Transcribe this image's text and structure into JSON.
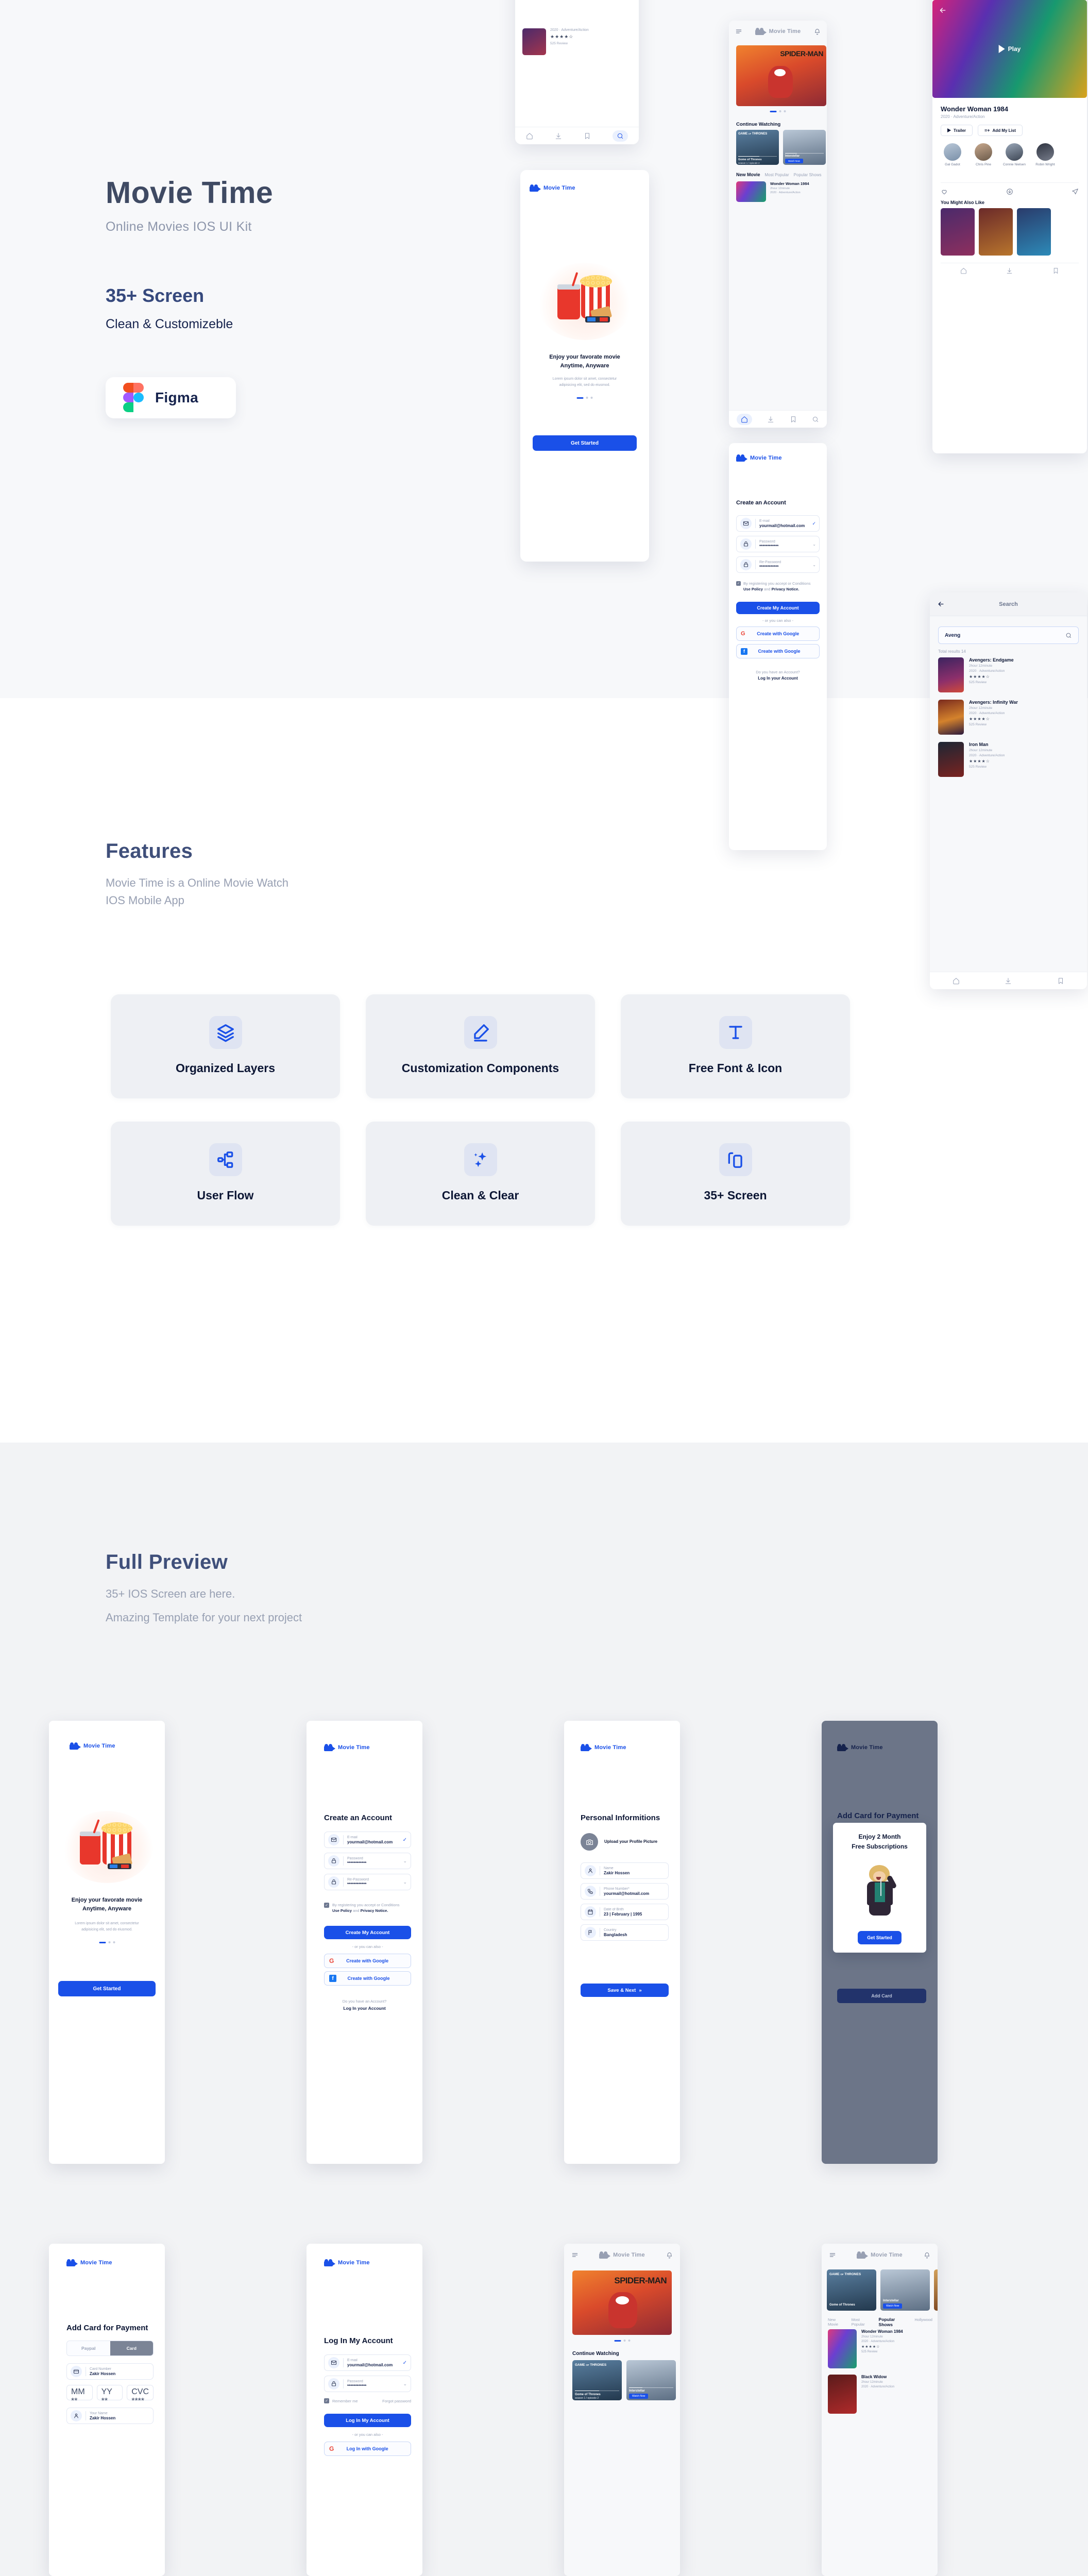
{
  "hero": {
    "title": "Movie Time",
    "subtitle": "Online Movies IOS UI Kit",
    "screens_count": "35+ Screen",
    "tagline": "Clean & Customizeble",
    "figma_label": "Figma"
  },
  "features": {
    "title": "Features",
    "subtitle_line1": "Movie Time is a Online Movie Watch",
    "subtitle_line2": "IOS Mobile App",
    "cards": [
      {
        "label": "Organized Layers",
        "icon": "layers-icon"
      },
      {
        "label": "Customization Components",
        "icon": "pencil-icon"
      },
      {
        "label": "Free Font & Icon",
        "icon": "text-icon"
      },
      {
        "label": "User Flow",
        "icon": "flow-icon"
      },
      {
        "label": "Clean & Clear",
        "icon": "sparkle-icon"
      },
      {
        "label": "35+ Screen",
        "icon": "devices-icon"
      }
    ]
  },
  "preview": {
    "title": "Full Preview",
    "subtitle_line1": "35+ IOS Screen are here.",
    "subtitle_line2": "Amazing Template for your next project"
  },
  "app": {
    "brand": "Movie Time",
    "onboarding": {
      "headline_line1": "Enjoy your favorate movie",
      "headline_line2": "Anytime, Anyware",
      "body_line1": "Lorem ipsum dolor sit amet, consectetur",
      "body_line2": "adipisicing elit, sed do eiusmod.",
      "cta": "Get Started"
    },
    "signup": {
      "title": "Create an Account",
      "fields": [
        {
          "label": "E-mail",
          "value": "yourmail@hotmail.com",
          "icon": "mail-icon"
        },
        {
          "label": "Password",
          "value": "************",
          "icon": "lock-icon"
        },
        {
          "label": "Re-Password",
          "value": "************",
          "icon": "lock-icon"
        }
      ],
      "consent_line1": "By registering you accept or Conditions",
      "consent_policy": "Use Policy",
      "consent_and": "and",
      "consent_notice": "Privacy Notice.",
      "primary_cta": "Create My Account",
      "divider": "- or you can also -",
      "google_cta": "Create with Google",
      "facebook_cta": "Create with Google",
      "footer_question": "Do you have an Account?",
      "footer_link": "Log In your Account"
    },
    "personal": {
      "title": "Personal Informitions",
      "upload_label": "Upload your Profile Picture",
      "fields": [
        {
          "label": "Name",
          "value": "Zakir Hossen",
          "icon": "user-icon"
        },
        {
          "label": "Phone Number*",
          "value": "yourmail@hotmail.com",
          "icon": "phone-icon"
        },
        {
          "label": "Date of Brith",
          "value": "23  |  February  |  1995",
          "icon": "calendar-icon"
        },
        {
          "label": "Country",
          "value": "Bangladesh",
          "icon": "flag-icon"
        }
      ],
      "cta": "Save & Next"
    },
    "payment": {
      "title": "Add Card for Payment",
      "tabs": [
        "Paypal",
        "Card"
      ],
      "active_tab": "Card",
      "fields": [
        {
          "label": "Card Number",
          "value": "Zakir Hossen",
          "icon": "card-icon"
        },
        {
          "label": "Your Name",
          "value": "Zakir Hossen",
          "icon": "user-icon"
        }
      ],
      "expiry": [
        {
          "label": "MM",
          "value": "**"
        },
        {
          "label": "YY",
          "value": "**"
        },
        {
          "label": "CVC",
          "value": "****"
        }
      ],
      "cta": "Add Card",
      "promo": {
        "headline_line1": "Enjoy 2 Month",
        "headline_line2": "Free Subscriptions",
        "cta": "Get Started"
      }
    },
    "login": {
      "title": "Log In My Account",
      "fields": [
        {
          "label": "E-mail",
          "value": "yourmail@hotmail.com",
          "icon": "mail-icon"
        },
        {
          "label": "Password",
          "value": "************",
          "icon": "lock-icon"
        }
      ],
      "remember": "Remember me",
      "forgot": "Forgot password",
      "primary_cta": "Log In My Account",
      "divider": "- or you can also -",
      "google_cta": "Log In with Google"
    },
    "home": {
      "hero_movie": "SPIDER-MAN",
      "continue_title": "Continue Watching",
      "continue": [
        {
          "title": "Gome of Thrones",
          "meta": "season 1 / episode 2",
          "progress": 55
        },
        {
          "title": "Interstellar",
          "meta": "Watch Now",
          "progress": 30
        }
      ],
      "tabs": [
        "New Movie",
        "Most Popular",
        "Popular Shows",
        "Hollywood"
      ],
      "active_tab": "New Movie",
      "list": [
        {
          "title": "Wonder Woman 1984",
          "duration": "2hour 12minute",
          "meta": "2020 · Adventure/Action"
        },
        {
          "title": "Black Widow",
          "duration": "2hour 12minute",
          "meta": "2020 · Adventure/Action"
        }
      ],
      "nav": [
        "home-icon",
        "download-icon",
        "bookmark-icon",
        "search-icon"
      ]
    },
    "detail": {
      "play_label": "Play",
      "title": "Wonder Woman 1984",
      "meta": "2020 · Adventure/Action",
      "trailer_btn": "Trailer",
      "addlist_btn": "Add My List",
      "cast": [
        "Gal Gadot",
        "Chris Pine",
        "Connie Nielsen",
        "Robin Wright"
      ],
      "also_like": "You Might Also Like",
      "actions": [
        "heart-icon",
        "download-icon",
        "share-icon"
      ]
    },
    "search": {
      "title": "Search",
      "query": "Aveng",
      "results_label": "Total results 14",
      "results": [
        {
          "title": "Avengers: Endgame",
          "duration": "2hour 12minute",
          "meta": "2020 · Adventure/Action",
          "stars": 4,
          "reviews": "525 Review"
        },
        {
          "title": "Avengers: Infinity War",
          "duration": "2hour 12minute",
          "meta": "2020 · Adventure/Action",
          "stars": 4,
          "reviews": "525 Review"
        },
        {
          "title": "Iron Man",
          "duration": "2hour 12minute",
          "meta": "2020 · Adventure/Action",
          "stars": 4,
          "reviews": "525 Review"
        }
      ]
    }
  },
  "colors": {
    "accent": "#1a50e8",
    "navy": "#16234d",
    "heading": "#3f4f7a",
    "muted": "#98a0b3",
    "slate": "#6e7890"
  }
}
